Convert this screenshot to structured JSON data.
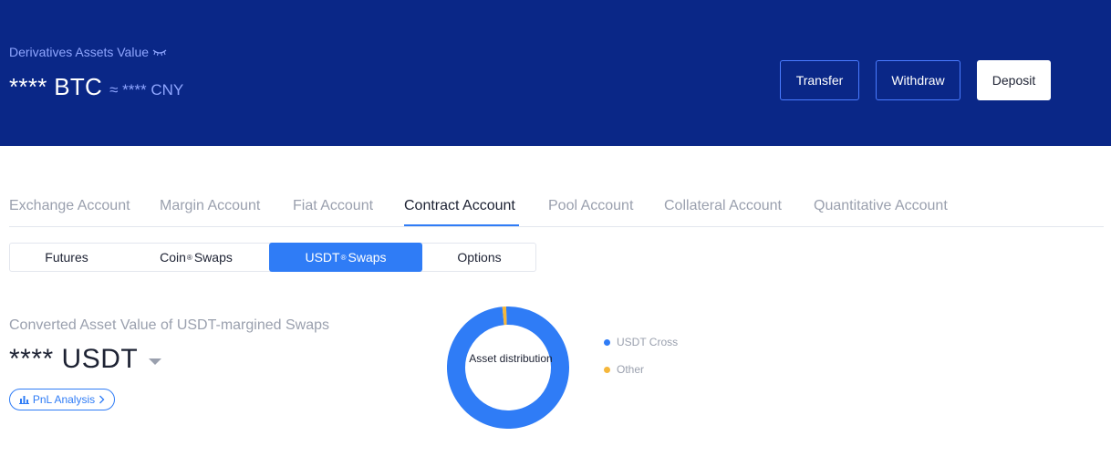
{
  "header": {
    "label": "Derivatives Assets Value",
    "value": "**** BTC",
    "approx": "≈ **** CNY",
    "buttons": {
      "transfer": "Transfer",
      "withdraw": "Withdraw",
      "deposit": "Deposit"
    }
  },
  "account_tabs": [
    {
      "label": "Exchange Account"
    },
    {
      "label": "Margin Account"
    },
    {
      "label": "Fiat Account"
    },
    {
      "label": "Contract Account",
      "active": true
    },
    {
      "label": "Pool Account"
    },
    {
      "label": "Collateral Account"
    },
    {
      "label": "Quantitative Account"
    }
  ],
  "segments": {
    "futures": "Futures",
    "coin": "Coin",
    "coin_suffix": "Swaps",
    "usdt": "USDT",
    "usdt_suffix": "Swaps",
    "options": "Options",
    "sup_mark": "®",
    "active": "USDT Swaps"
  },
  "asset": {
    "label": "Converted Asset Value of USDT-margined Swaps",
    "value": "**** USDT",
    "pnl_label": "PnL Analysis"
  },
  "chart_data": {
    "type": "pie",
    "title": "Asset distribution",
    "labels": [
      "USDT Cross",
      "Other"
    ],
    "values": [
      99,
      1
    ],
    "colors": [
      "#2f7cf6",
      "#f5b73b"
    ],
    "legend": "right"
  },
  "colors": {
    "brand_blue": "#2f7cf6",
    "header_bg": "#0a2787"
  }
}
